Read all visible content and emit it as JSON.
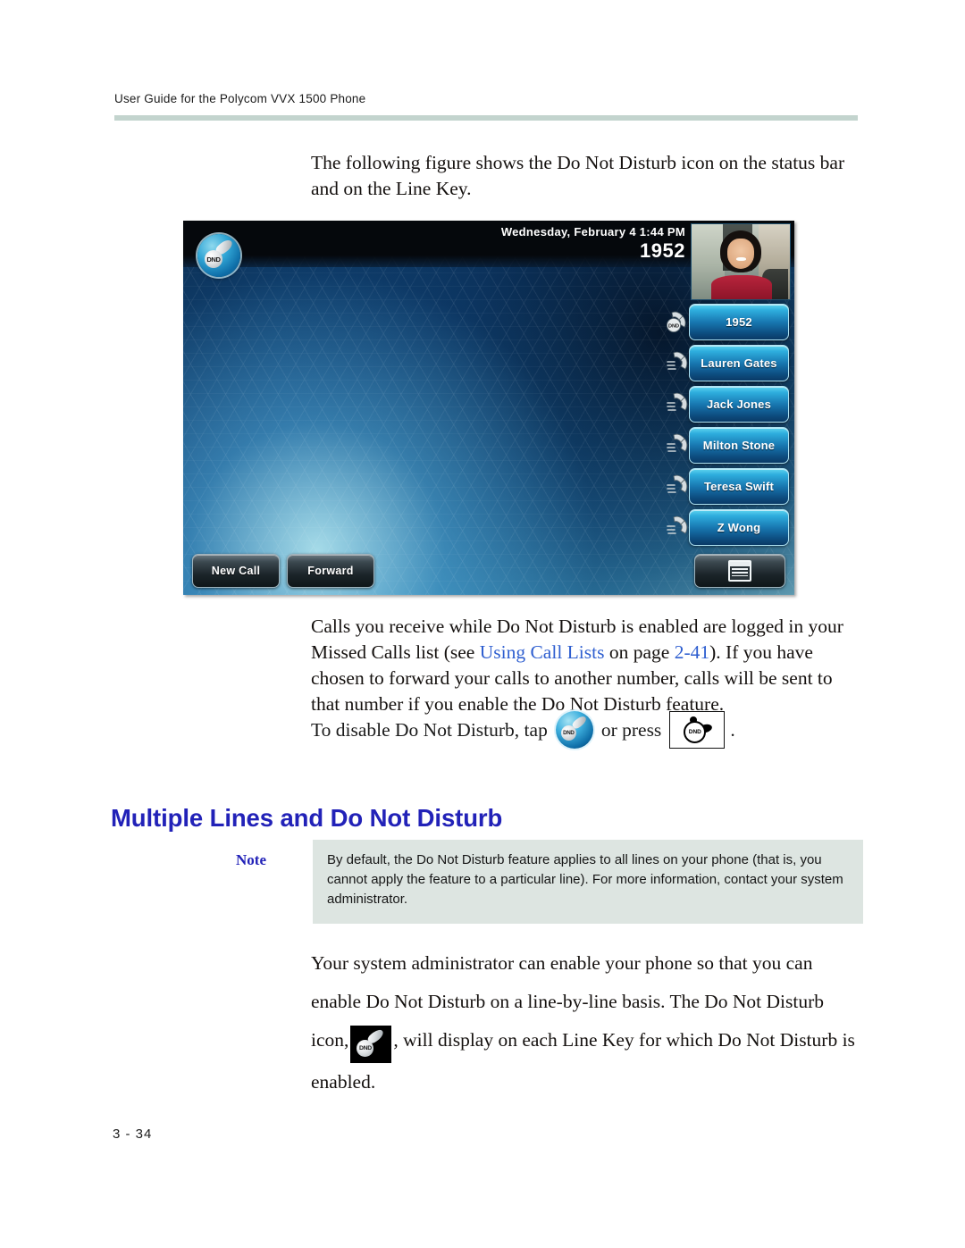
{
  "document": {
    "running_header": "User Guide for the Polycom VVX 1500 Phone",
    "page_number": "3 - 34"
  },
  "intro_paragraph": "The following figure shows the Do Not Disturb icon on the status bar and on the Line Key.",
  "phone_figure": {
    "status_bar": {
      "datetime": "Wednesday, February 4  1:44 PM",
      "extension": "1952"
    },
    "dnd_badge_label": "DND",
    "line_keys": [
      {
        "label": "1952",
        "icon": "dnd-handset-icon",
        "dnd": true,
        "dnd_label": "DND"
      },
      {
        "label": "Lauren Gates",
        "icon": "handset-icon",
        "dnd": false
      },
      {
        "label": "Jack Jones",
        "icon": "handset-icon",
        "dnd": false
      },
      {
        "label": "Milton Stone",
        "icon": "handset-icon",
        "dnd": false
      },
      {
        "label": "Teresa Swift",
        "icon": "handset-icon",
        "dnd": false
      },
      {
        "label": "Z Wong",
        "icon": "handset-icon",
        "dnd": false
      }
    ],
    "soft_keys": {
      "new_call": "New Call",
      "forward": "Forward",
      "menu_icon": "menu-list-icon"
    }
  },
  "calls_paragraph": {
    "part1": "Calls you receive while Do Not Disturb is enabled are logged in your Missed Calls list (see ",
    "link1": "Using Call Lists",
    "part2": " on page ",
    "link2": "2-41",
    "part3": "). If you have chosen to forward your calls to another number, calls will be sent to that number if you enable the Do Not Disturb feature."
  },
  "disable_line": {
    "part1": "To disable Do Not Disturb, tap",
    "tap_icon": "dnd-circle-icon",
    "part2": "or press",
    "press_icon": "dnd-key-icon",
    "part3": "."
  },
  "section": {
    "heading": "Multiple Lines and Do Not Disturb"
  },
  "note": {
    "label": "Note",
    "text": "By default, the Do Not Disturb feature applies to all lines on your phone (that is, you cannot apply the feature to a particular line). For more information, contact your system administrator."
  },
  "final_paragraph": {
    "part1": "Your system administrator can enable your phone so that you can enable Do Not Disturb on a line-by-line basis. The Do Not Disturb icon,",
    "icon": "dnd-square-icon",
    "part2": ", will display on each Line Key for which Do Not Disturb is enabled."
  },
  "colors": {
    "heading_blue": "#2222b8",
    "link_blue": "#2f5fd0",
    "header_rule": "#c3d4ce",
    "note_background": "#dde5e1"
  },
  "dnd_text": "DND"
}
